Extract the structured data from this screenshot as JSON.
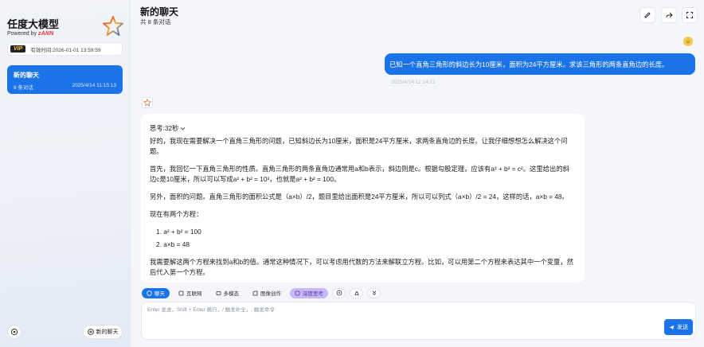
{
  "sidebar": {
    "brand": "任度大模型",
    "powered_prefix": "Powered by",
    "powered_brand": "zANN",
    "vip_badge": "VIP",
    "vip_expiry": "有效时间:2026-01-01 13:59:59",
    "chats": [
      {
        "title": "新的聊天",
        "count": "8 条对话",
        "date": "2025/4/14 11:15:13"
      }
    ],
    "new_chat_label": "新的聊天"
  },
  "header": {
    "title": "新的聊天",
    "subtitle": "共 8 条对话"
  },
  "messages": {
    "user_text": "已知一个直角三角形的斜边长为10厘米，面积为24平方厘米。求该三角形的两条直角边的长度。",
    "user_time": "2025/4/14 11:14:21",
    "think_label": "思考:32秒",
    "paragraphs": [
      "好的，我现在需要解决一个直角三角形的问题，已知斜边长为10厘米，面积是24平方厘米，求两条直角边的长度。让我仔细想想怎么解决这个问题。",
      "首先，我回忆一下直角三角形的性质。直角三角形的两条直角边通常用a和b表示，斜边则是c。根据勾股定理，应该有a² + b² = c²。这里给出的斜边c是10厘米，所以可以写成a² + b² = 10²，也就是a² + b² = 100。",
      "另外，面积的问题。直角三角形的面积公式是（a×b）/2，题目里给出面积是24平方厘米，所以可以列式（a×b）/2 = 24，这样的话，a×b = 48。",
      "现在有两个方程："
    ],
    "equations": [
      "1. a² + b² = 100",
      "2. a×b = 48"
    ],
    "last_paragraph": "我需要解这两个方程来找到a和b的值。通常这种情况下，可以考虑用代数的方法来解联立方程。比如，可以用第二个方程来表达其中一个变量，然后代入第一个方程。"
  },
  "composer": {
    "tools": [
      "聊天",
      "互联网",
      "多模态",
      "图像创作",
      "深度思考"
    ],
    "placeholder": "Enter 发送，Shift + Enter 换行，/ 触发补全，: 触发命令",
    "send_label": "发送"
  },
  "colors": {
    "accent": "#1a73e8",
    "deep_think": "#c9b8f5"
  }
}
